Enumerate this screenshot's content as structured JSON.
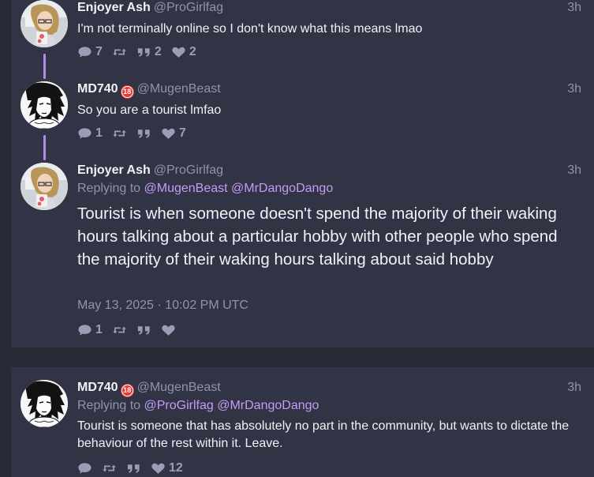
{
  "posts": [
    {
      "display_name": "Enjoyer Ash",
      "handle": "@ProGirlfag",
      "time": "3h",
      "text": "I'm not terminally online so I don't know what this means lmao",
      "counts": {
        "reply": "7",
        "retweet": "",
        "quote": "2",
        "like": "2"
      }
    },
    {
      "display_name": "MD740",
      "badge": "18",
      "handle": "@MugenBeast",
      "time": "3h",
      "text": "So you are a tourist lmfao",
      "counts": {
        "reply": "1",
        "retweet": "",
        "quote": "",
        "like": "7"
      }
    },
    {
      "display_name": "Enjoyer Ash",
      "handle": "@ProGirlfag",
      "time": "3h",
      "replying_prefix": "Replying to",
      "mentions": [
        "@MugenBeast",
        "@MrDangoDango"
      ],
      "text": "Tourist is when someone doesn't spend the majority of their waking hours talking about a particular hobby with other people who spend the majority of their waking hours talking about said hobby",
      "date": "May 13, 2025 · 10:02 PM UTC",
      "counts": {
        "reply": "1",
        "retweet": "",
        "quote": "",
        "like": ""
      }
    },
    {
      "display_name": "MD740",
      "badge": "18",
      "handle": "@MugenBeast",
      "time": "3h",
      "replying_prefix": "Replying to",
      "mentions": [
        "@ProGirlfag",
        "@MrDangoDango"
      ],
      "text": "Tourist is someone that has absolutely no part in the community, but wants to dictate the behaviour of the rest within it. Leave.",
      "counts": {
        "reply": "",
        "retweet": "",
        "quote": "",
        "like": "12"
      }
    }
  ],
  "colors": {
    "background": "#282a36",
    "panel": "#313444",
    "accent": "#c59cf5",
    "thread_line": "#b18bea",
    "muted": "#8f93b0"
  },
  "icons": {
    "reply": "comment-icon",
    "retweet": "retweet-icon",
    "quote": "quote-icon",
    "like": "heart-icon"
  }
}
